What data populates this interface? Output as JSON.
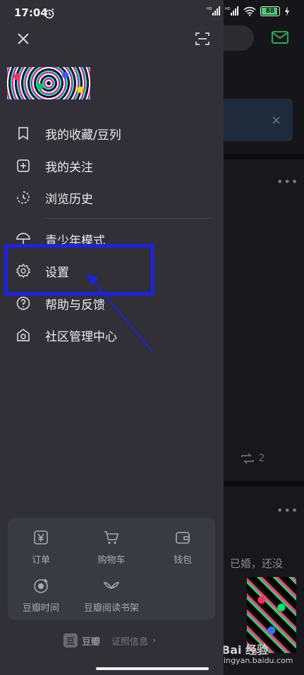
{
  "status_bar": {
    "time": "17:04",
    "network1": "HD",
    "network2": "HD",
    "battery": "88"
  },
  "drawer": {
    "menu": [
      {
        "label": "我的收藏/豆列",
        "icon": "bookmark-icon"
      },
      {
        "label": "我的关注",
        "icon": "plus-square-icon"
      },
      {
        "label": "浏览历史",
        "icon": "history-icon"
      },
      {
        "label": "青少年模式",
        "icon": "umbrella-icon"
      },
      {
        "label": "设置",
        "icon": "gear-icon"
      },
      {
        "label": "帮助与反馈",
        "icon": "help-icon"
      },
      {
        "label": "社区管理中心",
        "icon": "house-shield-icon"
      }
    ],
    "services": [
      {
        "label": "订单",
        "icon": "order-yen-icon"
      },
      {
        "label": "购物车",
        "icon": "cart-icon"
      },
      {
        "label": "钱包",
        "icon": "wallet-icon"
      },
      {
        "label": "豆瓣时间",
        "icon": "douban-time-icon"
      },
      {
        "label": "豆瓣阅读书架",
        "icon": "book-shelf-icon"
      }
    ],
    "footer": {
      "logo": "豆",
      "brand": "豆瓣",
      "license_link": "证照信息",
      "chevron": "›"
    }
  },
  "background": {
    "repost_count": "2",
    "snippet": "已婚，还没",
    "watermark": "Bai 经验",
    "watermark_url": "jingyan.baidu.com"
  },
  "colors": {
    "drawer_bg": "#303036",
    "highlight": "#1d22e6",
    "battery": "#3ed46b"
  }
}
